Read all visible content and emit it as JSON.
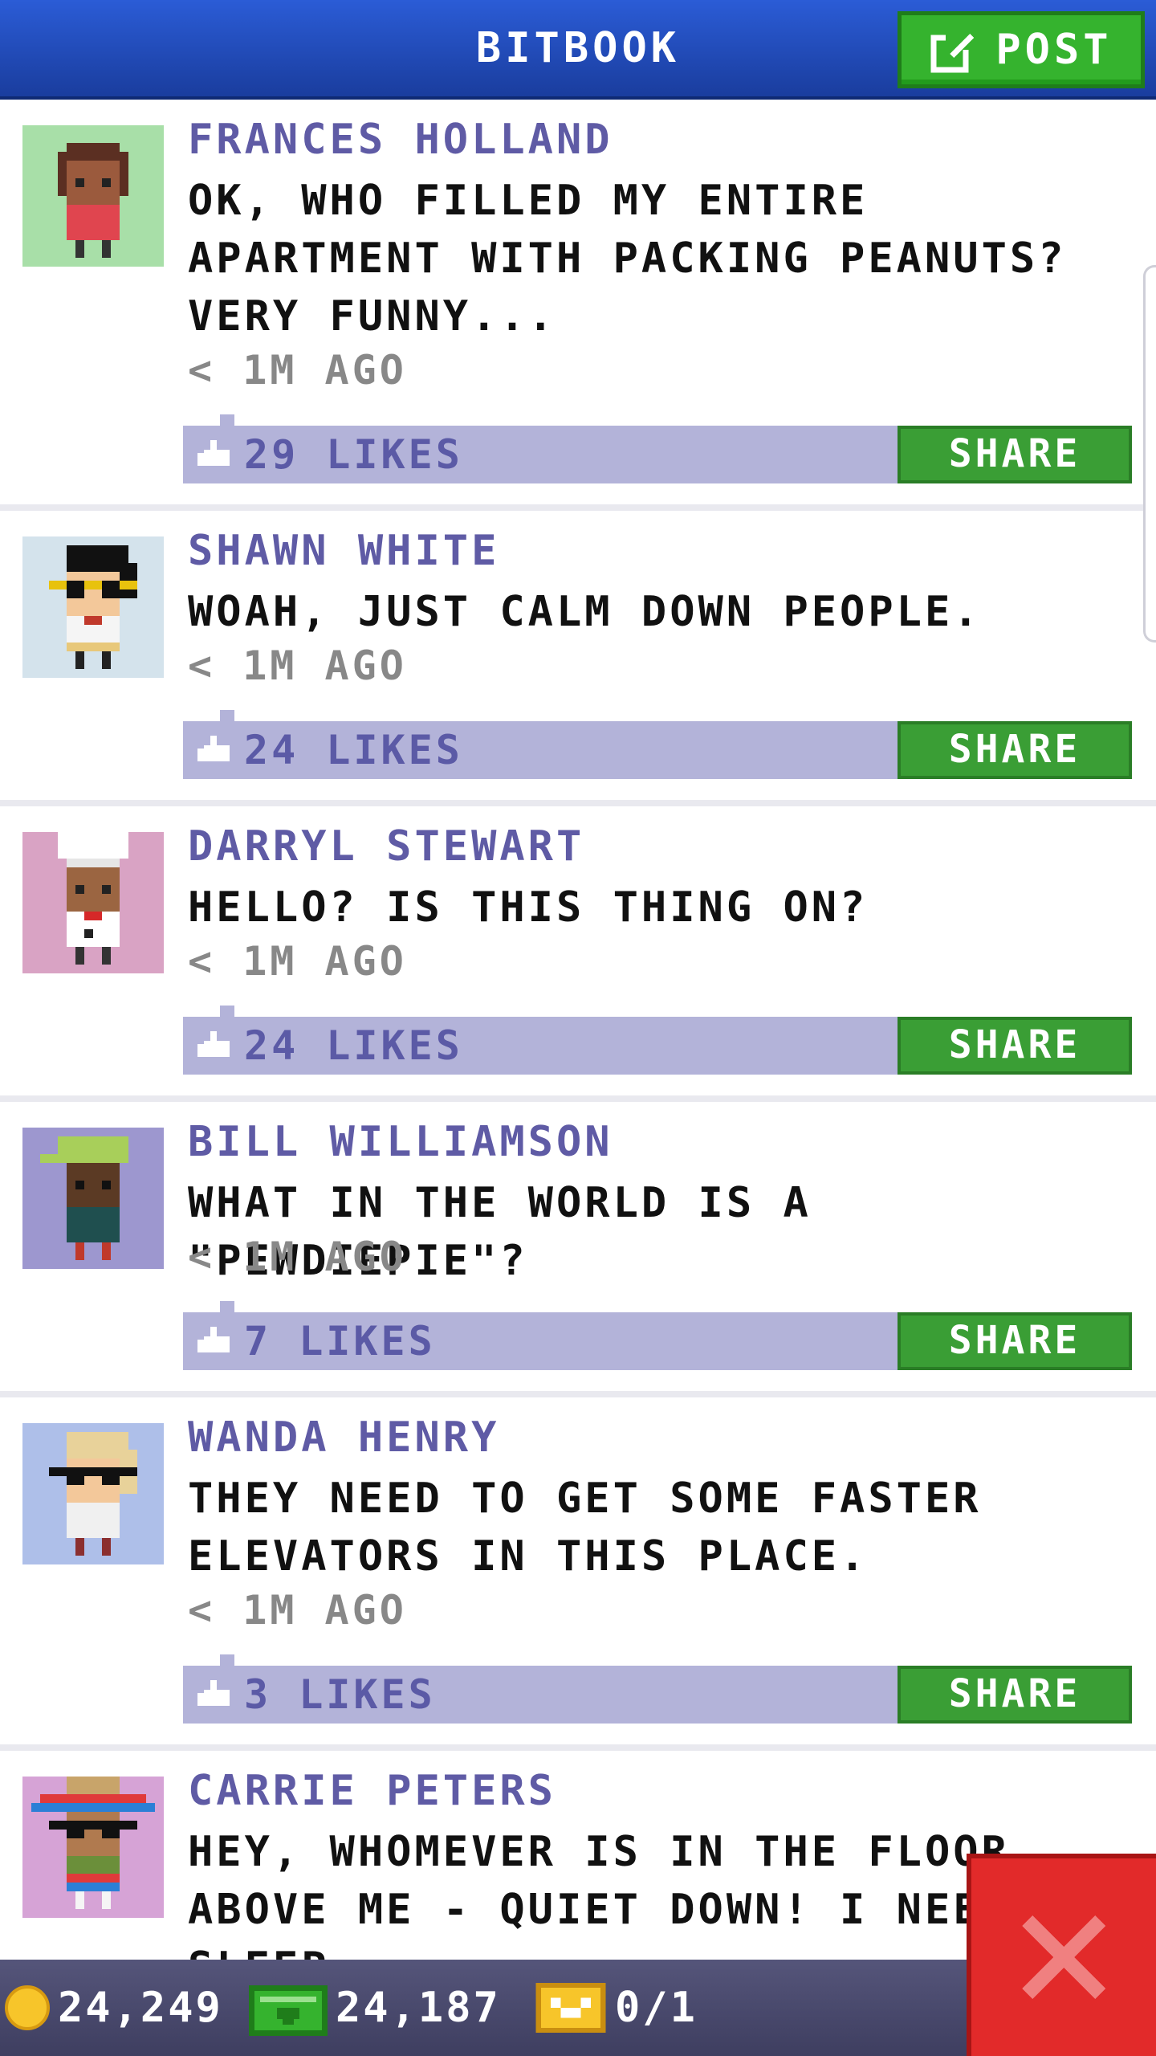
{
  "header": {
    "title": "BITBOOK",
    "post_label": "POST"
  },
  "colors": {
    "header_blue": "#2b5cd6",
    "name_purple": "#5f5ba5",
    "likes_bar": "#b3b3d9",
    "share_green": "#3a9e35",
    "close_red": "#e22a2a"
  },
  "posts": [
    {
      "name": "FRANCES HOLLAND",
      "message": "OK, WHO FILLED MY ENTIRE APARTMENT WITH PACKING PEANUTS? VERY FUNNY...",
      "time": "< 1M AGO",
      "likes": "29 LIKES",
      "share_label": "SHARE",
      "avatar_bg": "#a8dfa8"
    },
    {
      "name": "SHAWN WHITE",
      "message": "WOAH, JUST CALM DOWN PEOPLE.",
      "time": "< 1M AGO",
      "likes": "24 LIKES",
      "share_label": "SHARE",
      "avatar_bg": "#d4e3ec"
    },
    {
      "name": "DARRYL STEWART",
      "message": "HELLO? IS THIS THING ON?",
      "time": "< 1M AGO",
      "likes": "24 LIKES",
      "share_label": "SHARE",
      "avatar_bg": "#d9a3c4"
    },
    {
      "name": "BILL WILLIAMSON",
      "message": "WHAT IN THE WORLD IS A \"PEWDIEPIE\"?",
      "time": "< 1M AGO",
      "likes": "7 LIKES",
      "share_label": "SHARE",
      "avatar_bg": "#9d97cf"
    },
    {
      "name": "WANDA HENRY",
      "message": "THEY NEED TO GET SOME FASTER ELEVATORS IN THIS PLACE.",
      "time": "< 1M AGO",
      "likes": "3 LIKES",
      "share_label": "SHARE",
      "avatar_bg": "#aebfe9"
    },
    {
      "name": "CARRIE PETERS",
      "message": "HEY, WHOMEVER IS IN THE FLOOR ABOVE ME - QUIET DOWN! I NEED SLEEP.",
      "avatar_bg": "#d6a3d6"
    }
  ],
  "footer": {
    "coins": "24,249",
    "bux": "24,187",
    "tickets": "0/1"
  }
}
